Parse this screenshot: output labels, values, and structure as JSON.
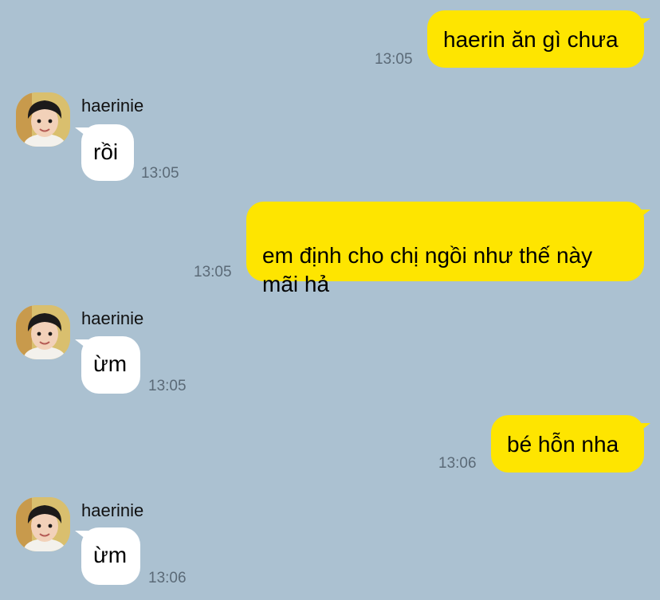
{
  "chat": {
    "messages": [
      {
        "direction": "outgoing",
        "text": "haerin ăn gì chưa",
        "time": "13:05"
      },
      {
        "direction": "incoming",
        "sender": "haerinie",
        "text": "rồi",
        "time": "13:05"
      },
      {
        "direction": "outgoing",
        "text": "em định cho chị ngồi như thế này\nmãi hả",
        "time": "13:05"
      },
      {
        "direction": "incoming",
        "sender": "haerinie",
        "text": "ừm",
        "time": "13:05"
      },
      {
        "direction": "outgoing",
        "text": "bé hỗn nha",
        "time": "13:06"
      },
      {
        "direction": "incoming",
        "sender": "haerinie",
        "text": "ừm",
        "time": "13:06"
      }
    ]
  },
  "colors": {
    "background": "#abc1d1",
    "outgoing_bubble": "#fee500",
    "incoming_bubble": "#ffffff",
    "time_text": "#5b6a77"
  },
  "icons": {
    "avatar": "profile-photo-avatar"
  }
}
